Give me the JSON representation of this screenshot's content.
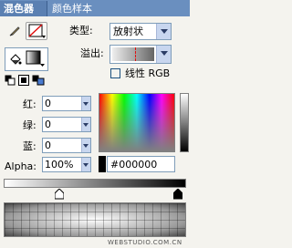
{
  "tabs": {
    "mixer": "混色器",
    "swatches": "颜色样本"
  },
  "fill": {
    "type_label": "类型:",
    "type_value": "放射状",
    "overflow_label": "溢出:",
    "linear_rgb_label": "线性 RGB"
  },
  "rgb": {
    "red_label": "红:",
    "red_value": "0",
    "green_label": "绿:",
    "green_value": "0",
    "blue_label": "蓝:",
    "blue_value": "0",
    "alpha_label": "Alpha:",
    "alpha_value": "100%",
    "hex_value": "#000000"
  },
  "colors": {
    "stroke_color": "#000000",
    "fill_color": "#ffffff",
    "selected_color": "#000000",
    "panel_bg": "#f4f3ee",
    "tab_bg": "#6a8fbf"
  },
  "watermark": "WEBSTUDIO.COM.CN"
}
